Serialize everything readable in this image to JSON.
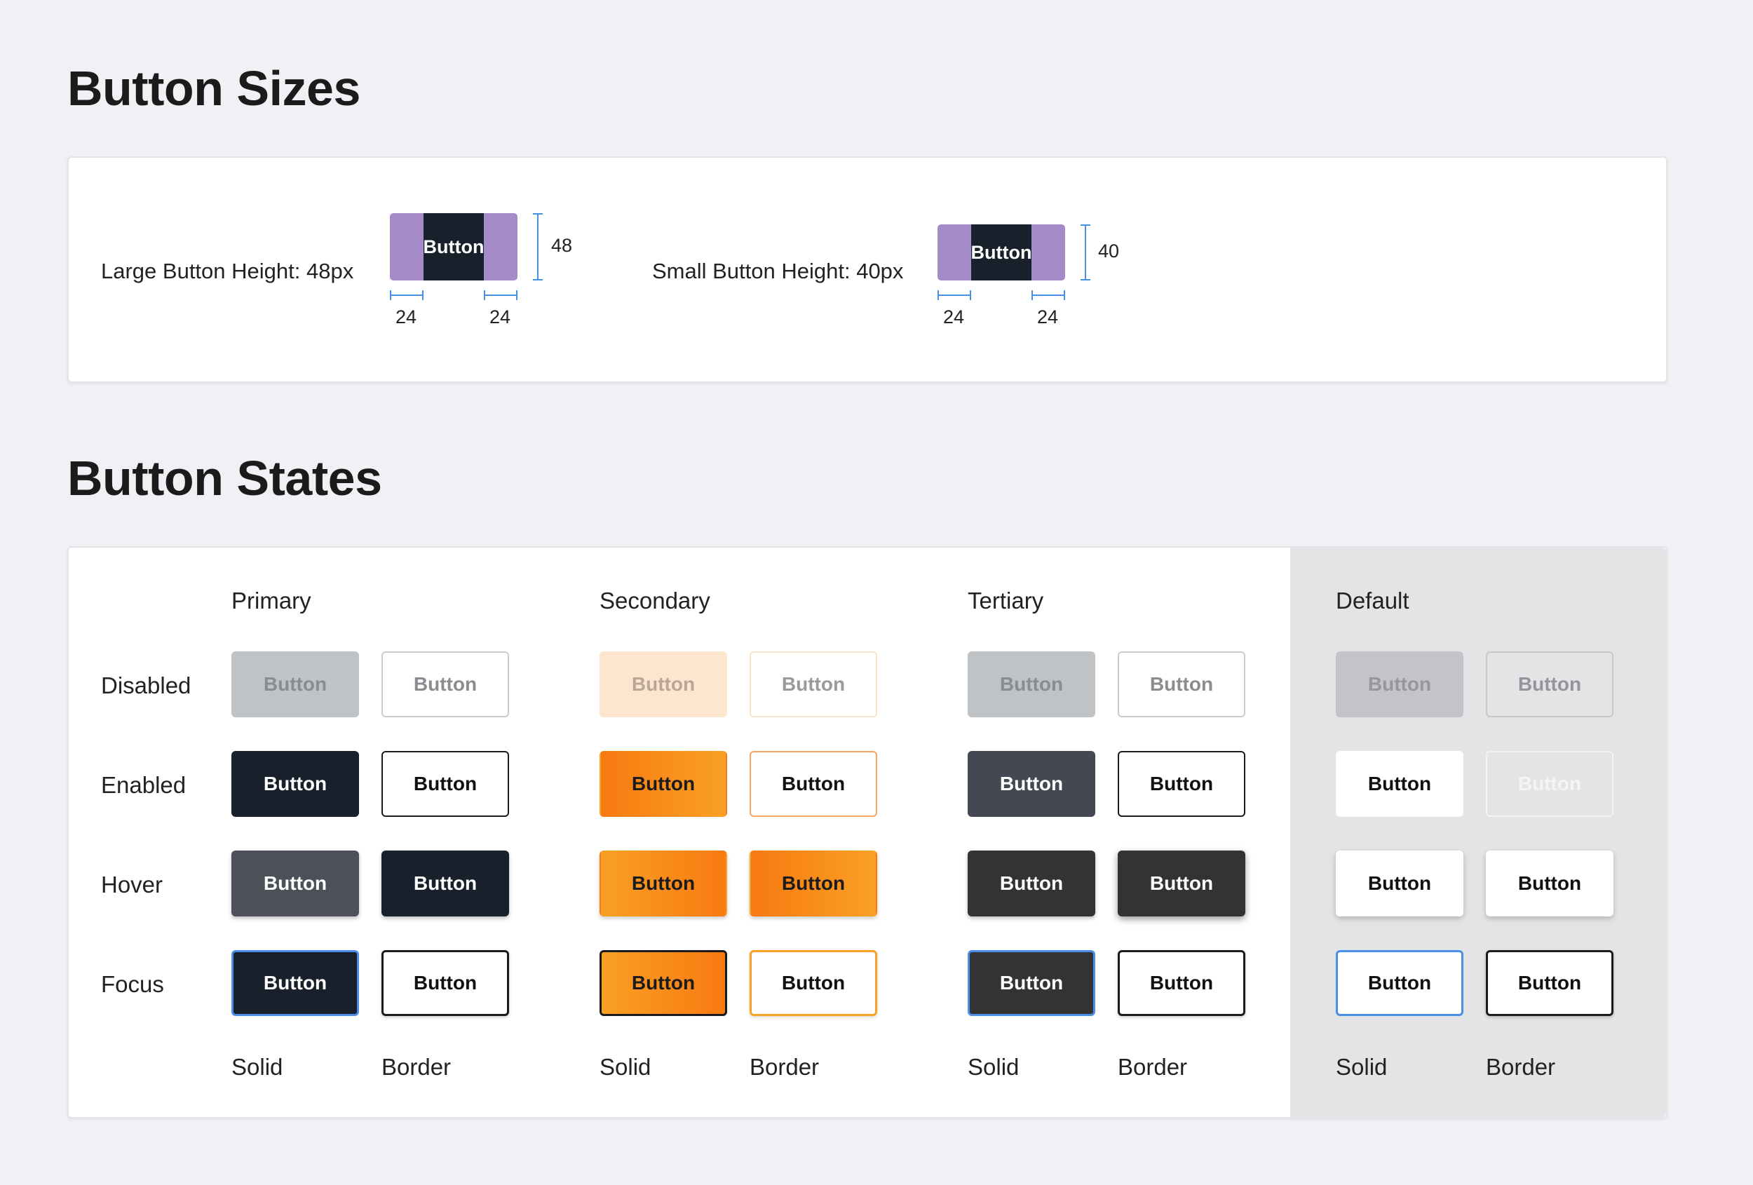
{
  "sizes": {
    "title": "Button Sizes",
    "large": {
      "label": "Large Button Height: 48px",
      "button_label": "Button",
      "height": "48",
      "pad_left": "24",
      "pad_right": "24"
    },
    "small": {
      "label": "Small Button Height: 40px",
      "button_label": "Button",
      "height": "40",
      "pad_left": "24",
      "pad_right": "24"
    },
    "colors": {
      "padding": "#a68bc9",
      "button": "#18212b",
      "measure": "#4a90e2"
    }
  },
  "states": {
    "title": "Button States",
    "groups": [
      "Primary",
      "Secondary",
      "Tertiary",
      "Default"
    ],
    "rows": [
      "Disabled",
      "Enabled",
      "Hover",
      "Focus"
    ],
    "variants": [
      "Solid",
      "Border"
    ],
    "button_label": "Button",
    "colors": {
      "primary": "#18212b",
      "secondary": "#f87a10",
      "tertiary": "#434852",
      "focus_ring": "#4a8ee8",
      "default_panel": "#e3e4e6"
    }
  }
}
